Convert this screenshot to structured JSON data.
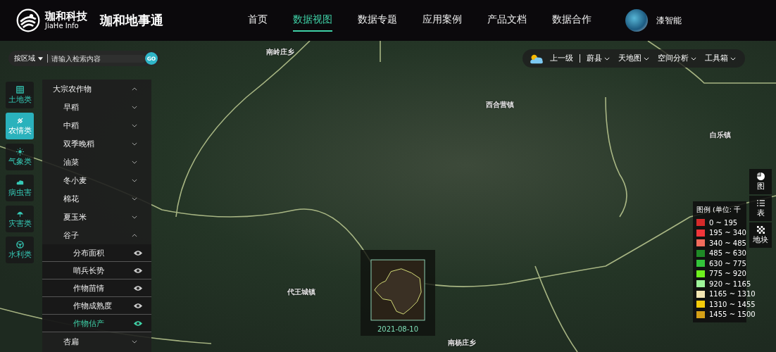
{
  "header": {
    "logo_name": "珈和科技",
    "logo_subtitle": "JiaHe Info",
    "product_name": "珈和地事通",
    "nav": [
      {
        "label": "首页",
        "selected": false
      },
      {
        "label": "数据视图",
        "selected": true
      },
      {
        "label": "数据专题",
        "selected": false
      },
      {
        "label": "应用案例",
        "selected": false
      },
      {
        "label": "产品文档",
        "selected": false
      },
      {
        "label": "数据合作",
        "selected": false
      }
    ],
    "user": {
      "name": "漆智能"
    }
  },
  "search": {
    "scope": "按区域",
    "placeholder": "请输入检索内容",
    "go": "GO"
  },
  "category_rail": [
    {
      "label": "土地类",
      "kind": "grid",
      "selected": false
    },
    {
      "label": "农情类",
      "kind": "satellite",
      "selected": true
    },
    {
      "label": "气象类",
      "kind": "sun",
      "selected": false
    },
    {
      "label": "病虫害",
      "kind": "cloud",
      "selected": false
    },
    {
      "label": "灾害类",
      "kind": "umbrella",
      "selected": false
    },
    {
      "label": "水利类",
      "kind": "wheel",
      "selected": false
    }
  ],
  "layer_tree": [
    {
      "label": "大宗农作物",
      "expanded": true,
      "children": [
        {
          "label": "早稻",
          "expanded": false
        },
        {
          "label": "中稻",
          "expanded": false
        },
        {
          "label": "双季晚稻",
          "expanded": false
        },
        {
          "label": "油菜",
          "expanded": false
        },
        {
          "label": "冬小麦",
          "expanded": false
        },
        {
          "label": "棉花",
          "expanded": false
        },
        {
          "label": "夏玉米",
          "expanded": false
        },
        {
          "label": "谷子",
          "expanded": true,
          "children": [
            {
              "label": "分布面积",
              "selected": false
            },
            {
              "label": "哨兵长势",
              "selected": false
            },
            {
              "label": "作物苗情",
              "selected": false
            },
            {
              "label": "作物成熟度",
              "selected": false
            },
            {
              "label": "作物估产",
              "selected": true
            }
          ]
        },
        {
          "label": "杏扁",
          "expanded": false
        }
      ]
    }
  ],
  "toolbar": {
    "up": "上一级",
    "region": "蔚县",
    "menus": [
      "天地图",
      "空间分析",
      "工具箱"
    ]
  },
  "map": {
    "labels": [
      "南岭庄乡",
      "西合营镇",
      "白乐镇",
      "代王城镇",
      "南杨庄乡"
    ],
    "inset_date": "2021-08-10"
  },
  "side_tools": [
    {
      "label": "图",
      "kind": "pie"
    },
    {
      "label": "表",
      "kind": "list"
    },
    {
      "label": "地块",
      "kind": "checker"
    }
  ],
  "legend": {
    "title": "图例 (单位: 千",
    "items": [
      {
        "label": "0 ~ 195",
        "color": "#d42a2a"
      },
      {
        "label": "195 ~ 340",
        "color": "#f0353a"
      },
      {
        "label": "340 ~ 485",
        "color": "#f26b5c"
      },
      {
        "label": "485 ~ 630",
        "color": "#1f8a26"
      },
      {
        "label": "630 ~ 775",
        "color": "#33c43a"
      },
      {
        "label": "775 ~ 920",
        "color": "#6ef01e"
      },
      {
        "label": "920 ~ 1165",
        "color": "#9ef59a"
      },
      {
        "label": "1165 ~ 1310",
        "color": "#f3e6b3"
      },
      {
        "label": "1310 ~ 1455",
        "color": "#f5cc0a"
      },
      {
        "label": "1455 ~ 1500",
        "color": "#d4a017"
      }
    ]
  }
}
